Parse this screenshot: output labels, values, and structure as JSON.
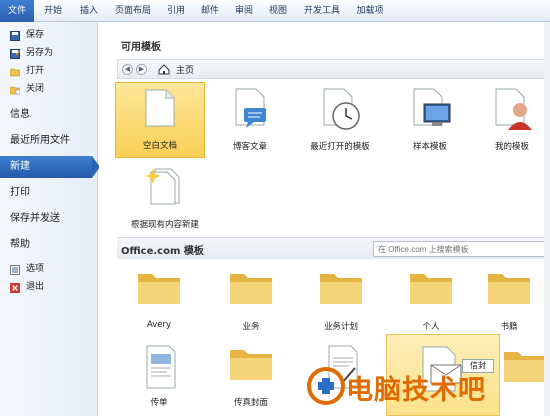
{
  "ribbon": {
    "tabs": [
      "文件",
      "开始",
      "插入",
      "页面布局",
      "引用",
      "邮件",
      "审阅",
      "视图",
      "开发工具",
      "加载项"
    ]
  },
  "nav": {
    "commands_top": [
      {
        "label": "保存",
        "icon": "save-icon"
      },
      {
        "label": "另存为",
        "icon": "save-as-icon"
      },
      {
        "label": "打开",
        "icon": "open-folder-icon"
      },
      {
        "label": "关闭",
        "icon": "close-folder-icon"
      }
    ],
    "sections": [
      "信息",
      "最近所用文件",
      "新建",
      "打印",
      "保存并发送",
      "帮助"
    ],
    "active_section": "新建",
    "commands_bottom": [
      {
        "label": "选项",
        "icon": "options-icon"
      },
      {
        "label": "退出",
        "icon": "exit-icon"
      }
    ]
  },
  "main": {
    "available_title": "可用模板",
    "breadcrumb": "主页",
    "templates": [
      {
        "label": "空白文档",
        "icon": "blank-document-icon"
      },
      {
        "label": "博客文章",
        "icon": "blog-post-icon"
      },
      {
        "label": "最近打开的模板",
        "icon": "recent-templates-icon"
      },
      {
        "label": "样本模板",
        "icon": "sample-templates-icon"
      },
      {
        "label": "我的模板",
        "icon": "my-templates-icon"
      },
      {
        "label": "根据现有内容新建",
        "icon": "new-from-existing-icon"
      }
    ],
    "office_title": "Office.com 模板",
    "search_placeholder": "在 Office.com 上搜索模板",
    "office_folders": [
      "Avery",
      "业务",
      "业务计划",
      "个人",
      "书籍"
    ],
    "office_row2": [
      "传单",
      "传真封面",
      "",
      "",
      ""
    ],
    "badge": "信封"
  },
  "watermark": "电脑技术吧",
  "colors": {
    "accent": "#2a5fae",
    "selected_tile": "#f9cf55",
    "folder": "#f3c861",
    "watermark": "#e06b00"
  }
}
